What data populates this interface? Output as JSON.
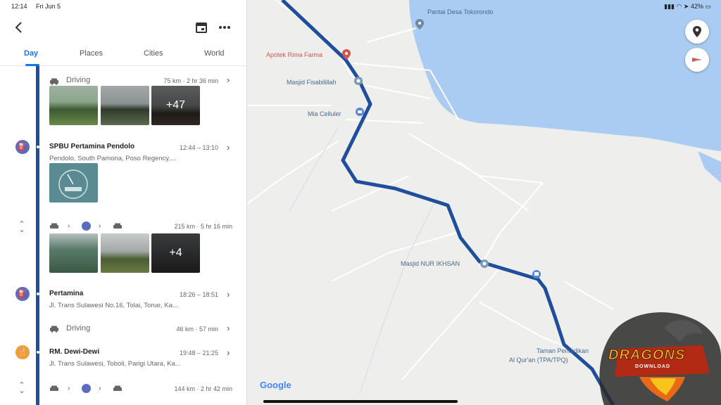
{
  "status": {
    "time": "12:14",
    "date": "Fri Jun 5",
    "battery": "42%"
  },
  "tabs": [
    {
      "label": "Day",
      "active": true
    },
    {
      "label": "Places",
      "active": false
    },
    {
      "label": "Cities",
      "active": false
    },
    {
      "label": "World",
      "active": false
    }
  ],
  "timeline": {
    "driving1": {
      "label": "Driving",
      "meta": "75 km · 2 hr 36 min",
      "photo_count": "+47"
    },
    "stop1": {
      "name": "SPBU Pertamina Pendolo",
      "time": "12:44 – 13:10",
      "address": "Pendolo, South Pamona, Poso Regency,..."
    },
    "trip1": {
      "meta": "215 km · 5 hr 16 min",
      "photo_count": "+4"
    },
    "stop2": {
      "name": "Pertamina",
      "time": "18:26 – 18:51",
      "address": "Jl. Trans Sulawesi No.16, Tolai, Torue, Ka..."
    },
    "driving2": {
      "label": "Driving",
      "meta": "46 km · 57 min"
    },
    "stop3": {
      "name": "RM. Dewi-Dewi",
      "time": "19:48 – 21:25",
      "address": "Jl. Trans Sulawesi, Toboli, Parigi Utara, Ka..."
    },
    "trip2": {
      "meta": "144 km · 2 hr 42 min"
    }
  },
  "map": {
    "pois": [
      {
        "label": "Pantai Desa Tokorondo",
        "icon": "pin-icon"
      },
      {
        "label": "Apotek Rima Farma",
        "icon": "pharmacy-icon"
      },
      {
        "label": "Masjid Fisabilillah",
        "icon": "mosque-icon"
      },
      {
        "label": "Mia Celluler",
        "icon": "shop-icon"
      },
      {
        "label": "Masjid NUR IKHSAN",
        "icon": "mosque-icon"
      },
      {
        "label": "Taman Pendidikan",
        "icon": "school-icon"
      },
      {
        "label": "Al Qur'an (TPA/TPQ)",
        "icon": "school-icon"
      }
    ],
    "google_logo": "Google"
  },
  "watermark": {
    "title": "DRAGONS",
    "subtitle": "DOWNLOAD"
  },
  "colors": {
    "route": "#1f4e9c",
    "accent": "#1a73e8",
    "water": "#aacbf2",
    "fuel": "#5c6bc0",
    "food": "#f29d38"
  }
}
